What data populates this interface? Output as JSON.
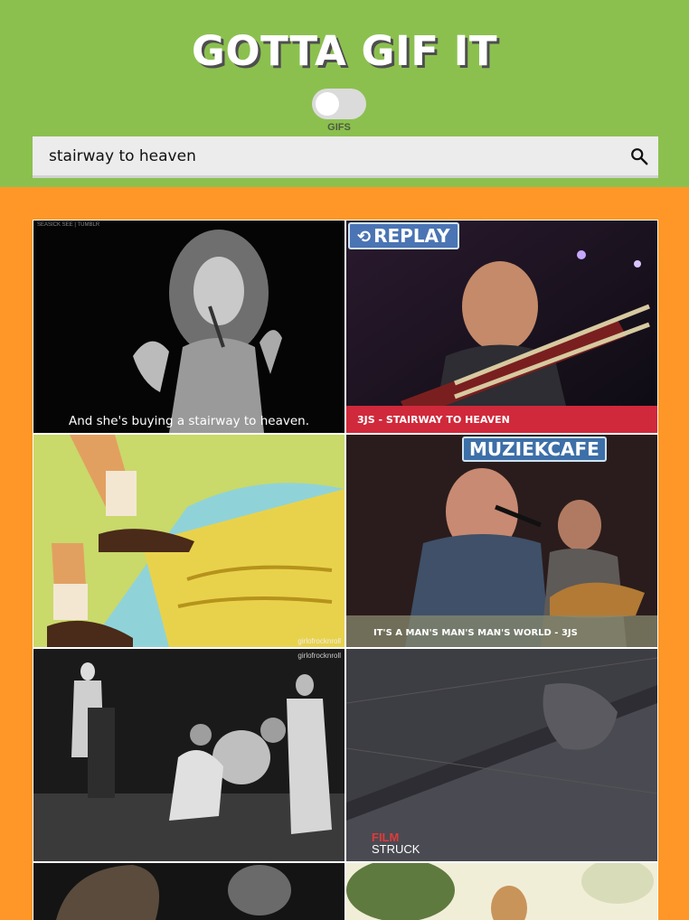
{
  "app": {
    "title": "GOTTA GIF IT",
    "toggle_label": "GIFS"
  },
  "search": {
    "value": "stairway to heaven",
    "icon": "search-icon"
  },
  "gifs": [
    {
      "caption": "And she's buying a stairway to heaven.",
      "watermark": "SEASICK SEE | TUMBLR"
    },
    {
      "badge": "REPLAY",
      "caption": "3JS - STAIRWAY TO HEAVEN"
    },
    {
      "watermark": "girlofrocknroll"
    },
    {
      "badge": "MUZIEKCAFE",
      "caption": "IT'S A MAN'S MAN'S MAN'S WORLD - 3JS"
    },
    {
      "watermark": "girlofrocknroll"
    },
    {
      "logo_top": "FILM",
      "logo_bottom": "STRUCK"
    },
    {},
    {}
  ],
  "colors": {
    "header_bg": "#8bc04f",
    "body_bg": "#fe9727",
    "search_bg": "#ececec"
  }
}
